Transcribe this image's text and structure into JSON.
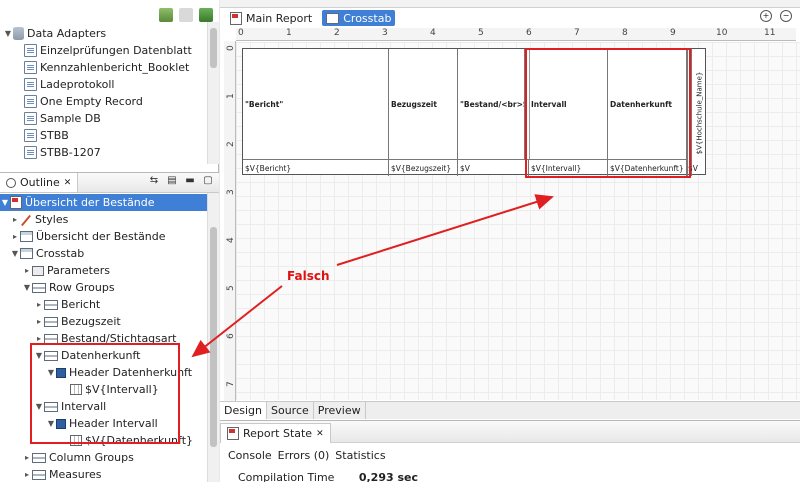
{
  "data_adapters": {
    "root_label": "Data Adapters",
    "items": [
      "Einzelprüfungen Datenblatt",
      "Kennzahlenbericht_Booklet",
      "Ladeprotokoll",
      "One Empty Record",
      "Sample DB",
      "STBB",
      "STBB-1207"
    ]
  },
  "outline": {
    "tab_label": "Outline",
    "tree": {
      "root": "Übersicht der Bestände",
      "styles": "Styles",
      "dataset": "Übersicht der Bestände",
      "crosstab": "Crosstab",
      "parameters": "Parameters",
      "row_groups": "Row Groups",
      "rg_bericht": "Bericht",
      "rg_bezugszeit": "Bezugszeit",
      "rg_bestand": "Bestand/Stichtagsart",
      "rg_datenherkunft": "Datenherkunft",
      "hdr_datenherkunft": "Header Datenherkunft",
      "field_intervall": "$V{Intervall}",
      "rg_intervall": "Intervall",
      "hdr_intervall": "Header Intervall",
      "field_datenherkunft": "$V{Datenherkunft}",
      "column_groups": "Column Groups",
      "measures": "Measures"
    }
  },
  "editor": {
    "tabs": [
      "Main Report",
      "Crosstab"
    ],
    "active_tab": "Crosstab",
    "ruler_h": [
      "0",
      "1",
      "2",
      "3",
      "4",
      "5",
      "6",
      "7",
      "8",
      "9",
      "10",
      "11"
    ],
    "ruler_v": [
      "0",
      "1",
      "2",
      "3",
      "4",
      "5",
      "6",
      "7"
    ],
    "crosstab": {
      "headers": [
        "\"Bericht\"",
        "Bezugszeit",
        "\"Bestand/<br>Stichtagsart\"",
        "Intervall",
        "Datenherkunft"
      ],
      "details": [
        "$V{Bericht}",
        "$V{Bezugszeit}",
        "$V",
        "$V{Intervall}",
        "$V{Datenherkunft}",
        "$V"
      ],
      "rotated_header": "$V{Hochschule_Name}"
    },
    "bottom_tabs": [
      "Design",
      "Source",
      "Preview"
    ],
    "active_bottom_tab": "Design"
  },
  "report_state": {
    "tab_label": "Report State",
    "links": [
      "Console",
      "Errors (0)",
      "Statistics"
    ],
    "metric_label": "Compilation Time",
    "metric_value": "0,293 sec"
  },
  "annotation": {
    "label": "Falsch",
    "color": "#e02020"
  }
}
